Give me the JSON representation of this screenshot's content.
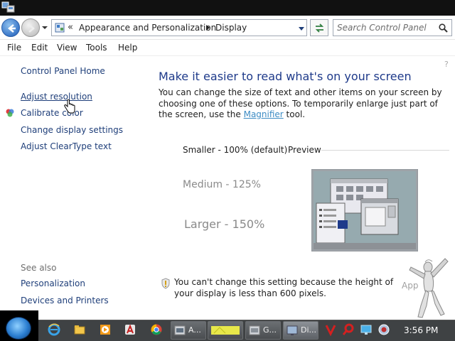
{
  "address": {
    "back_icon": "back-arrow-icon",
    "forward_icon": "forward-arrow-icon",
    "overflow": "«",
    "crumb_parent": "Appearance and Personalization",
    "crumb_current": "Display",
    "search_placeholder": "Search Control Panel"
  },
  "menu": [
    "File",
    "Edit",
    "View",
    "Tools",
    "Help"
  ],
  "sidebar": {
    "home": "Control Panel Home",
    "links": [
      "Adjust resolution",
      "Calibrate color",
      "Change display settings",
      "Adjust ClearType text"
    ],
    "see_also_label": "See also",
    "see_also_links": [
      "Personalization",
      "Devices and Printers"
    ]
  },
  "main": {
    "heading": "Make it easier to read what's on your screen",
    "desc_before": "You can change the size of text and other items on your screen by choosing one of these options. To temporarily enlarge just part of the screen, use the ",
    "desc_link": "Magnifier",
    "desc_after": " tool.",
    "options": [
      "Smaller - 100% (default)",
      "Medium - 125%",
      "Larger - 150%"
    ],
    "preview_label": "Preview",
    "warning": "You can't change this setting because the height of your display is less than 600 pixels.",
    "apply_partial": "App"
  },
  "taskbar": {
    "tasks": [
      {
        "label": "A...",
        "icon": "window-thumbnail-icon"
      },
      {
        "label": "",
        "icon": "yellow-app-icon"
      },
      {
        "label": "G...",
        "icon": "window-thumbnail-icon"
      },
      {
        "label": "Di...",
        "icon": "display-thumbnail-icon"
      }
    ],
    "clock": "3:56 PM"
  },
  "colors": {
    "link": "#1f3f7a",
    "heading": "#1e3a8a",
    "magnifier_link": "#3d8cc4",
    "taskbar": "#3f4244"
  }
}
